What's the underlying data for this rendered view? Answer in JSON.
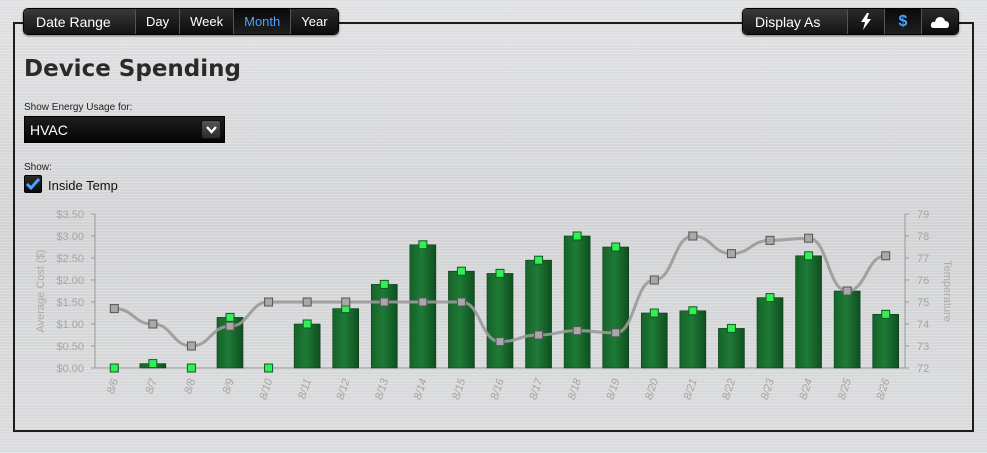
{
  "date_range": {
    "label": "Date Range",
    "options": [
      "Day",
      "Week",
      "Month",
      "Year"
    ],
    "selected": "Month"
  },
  "display_as": {
    "label": "Display As",
    "options": [
      {
        "icon": "lightning-icon",
        "glyph": "⚡"
      },
      {
        "icon": "dollar-icon",
        "glyph": "$"
      },
      {
        "icon": "cloud-icon",
        "glyph": "☁"
      }
    ],
    "selected": "dollar-icon"
  },
  "page": {
    "title": "Device Spending",
    "energy_label": "Show Energy Usage for:",
    "device_selected": "HVAC",
    "show_label": "Show:",
    "inside_temp_label": "Inside Temp",
    "inside_temp_checked": true
  },
  "colors": {
    "bar": "#1f7a37",
    "bar_marker": "#33ee55",
    "temp_line": "#9a9a9a",
    "temp_marker": "#a8a8a8",
    "selected_text": "#4aa3ff"
  },
  "chart_data": {
    "type": "bar",
    "categories": [
      "8/6",
      "8/7",
      "8/8",
      "8/9",
      "8/10",
      "8/11",
      "8/12",
      "8/13",
      "8/14",
      "8/15",
      "8/16",
      "8/17",
      "8/18",
      "8/19",
      "8/20",
      "8/21",
      "8/22",
      "8/23",
      "8/24",
      "8/25",
      "8/26"
    ],
    "series": [
      {
        "axis": "left",
        "type": "bar",
        "values": [
          0.0,
          0.1,
          0.0,
          1.15,
          0.0,
          1.0,
          1.35,
          1.9,
          2.8,
          2.2,
          2.15,
          2.45,
          3.0,
          2.75,
          1.25,
          1.3,
          0.9,
          1.6,
          2.55,
          1.75,
          1.22
        ]
      },
      {
        "axis": "right",
        "type": "line",
        "values": [
          74.7,
          74.0,
          73.0,
          73.9,
          75.0,
          75.0,
          75.0,
          75.0,
          75.0,
          75.0,
          73.2,
          73.5,
          73.7,
          73.6,
          76.0,
          78.0,
          77.2,
          77.8,
          77.9,
          75.5,
          77.1
        ]
      }
    ],
    "ylabel": "Average Cost ($)",
    "ylabel_right": "Temperature",
    "ylim": [
      0,
      3.5
    ],
    "yticks": [
      "$0.00",
      "$0.50",
      "$1.00",
      "$1.50",
      "$2.00",
      "$2.50",
      "$3.00",
      "$3.50"
    ],
    "ylim_right": [
      72,
      79
    ],
    "yticks_right": [
      "72",
      "73",
      "74",
      "75",
      "76",
      "77",
      "78",
      "79"
    ],
    "legend": "none",
    "grid": false
  }
}
